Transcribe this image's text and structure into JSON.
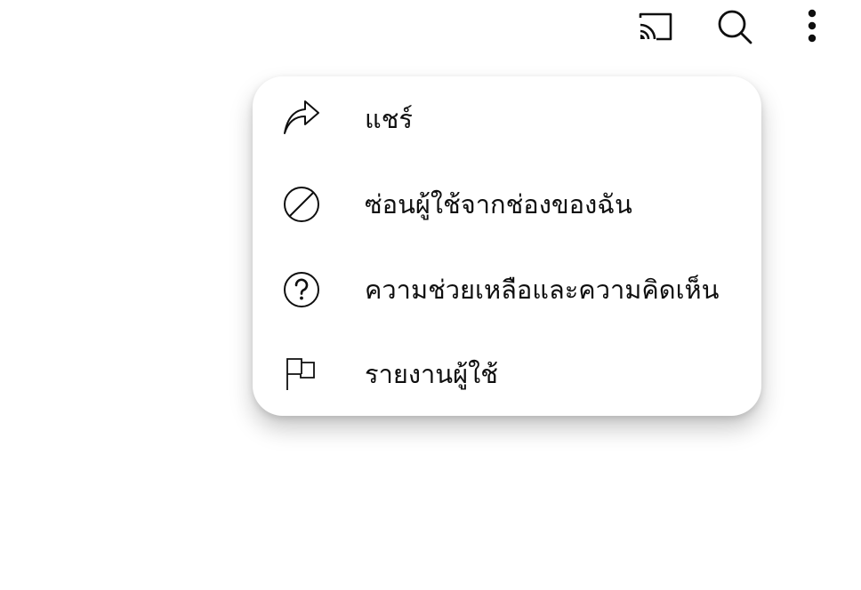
{
  "topbar": {
    "icons": [
      "cast-icon",
      "search-icon",
      "more-vertical-icon"
    ]
  },
  "menu": {
    "items": [
      {
        "label": "แชร์",
        "icon": "share-icon"
      },
      {
        "label": "ซ่อนผู้ใช้จากช่องของฉัน",
        "icon": "block-icon"
      },
      {
        "label": "ความช่วยเหลือและความคิดเห็น",
        "icon": "help-icon"
      },
      {
        "label": "รายงานผู้ใช้",
        "icon": "flag-icon"
      }
    ]
  },
  "colors": {
    "icon": "#0f0f0f",
    "text": "#0f0f0f",
    "background": "#ffffff"
  }
}
